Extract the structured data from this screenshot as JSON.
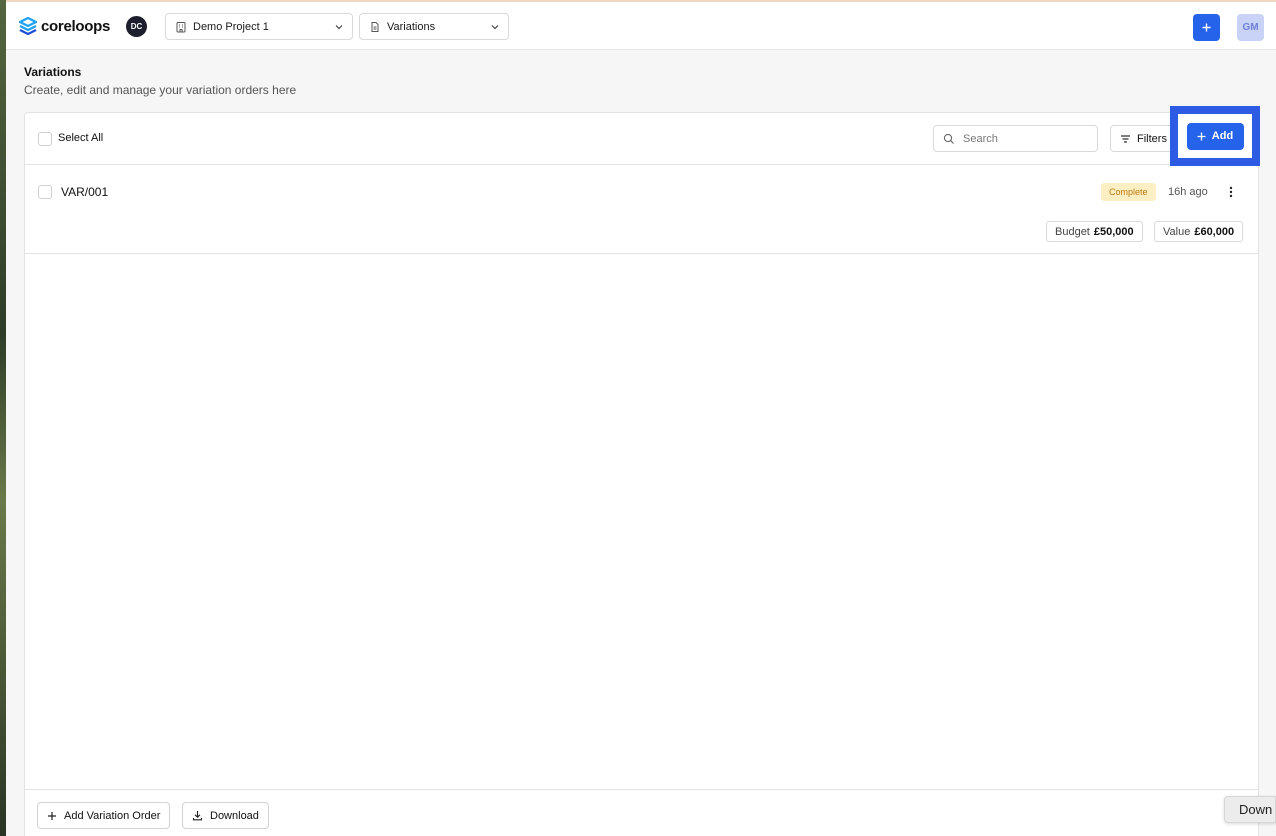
{
  "brand": {
    "name": "coreloops"
  },
  "header": {
    "org_initials": "DC",
    "project_selector": {
      "value": "Demo Project 1"
    },
    "module_selector": {
      "value": "Variations"
    },
    "add_button": "+",
    "user_initials": "GM"
  },
  "page": {
    "title": "Variations",
    "subtitle": "Create, edit and manage your variation orders here"
  },
  "toolbar": {
    "select_all_label": "Select All",
    "search_placeholder": "Search",
    "filters_label": "Filters",
    "add_label": "Add"
  },
  "variations": [
    {
      "ref": "VAR/001",
      "status": "Complete",
      "time": "16h ago",
      "budget_label": "Budget",
      "budget_value": "£50,000",
      "value_label": "Value",
      "value_value": "£60,000"
    }
  ],
  "footer": {
    "add_variation_label": "Add Variation Order",
    "download_label": "Download"
  },
  "corner_chip": {
    "text": "Down"
  },
  "colors": {
    "primary": "#2563eb",
    "highlight": "#2d5be3",
    "status_complete_bg": "#fdefc4",
    "status_complete_text": "#c0790a"
  }
}
